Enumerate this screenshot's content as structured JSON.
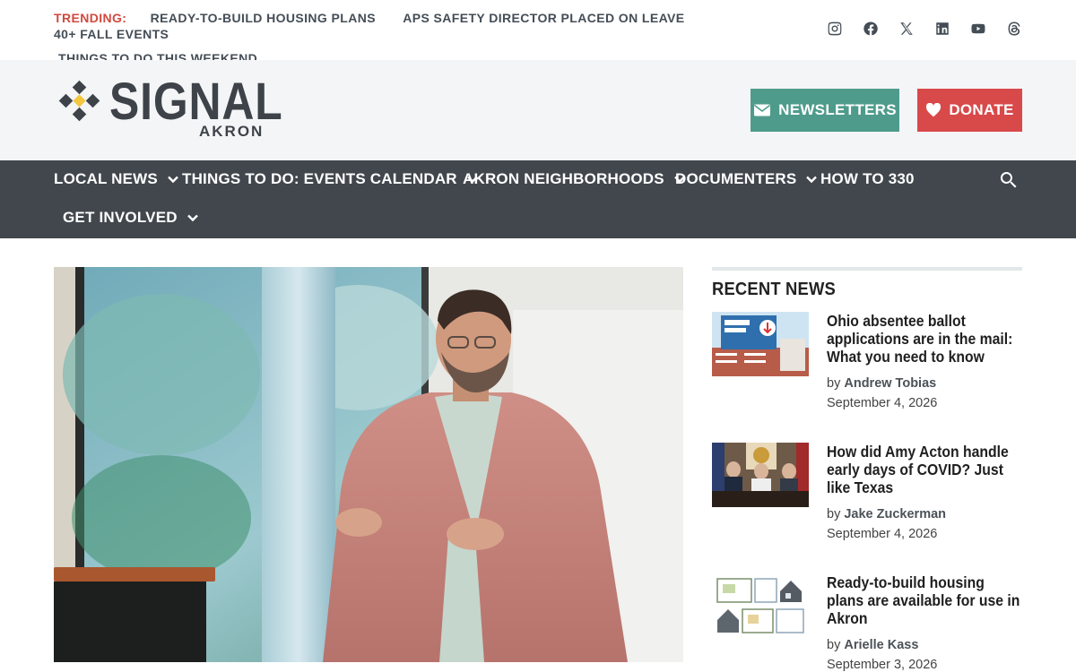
{
  "trending": {
    "label": "TRENDING:",
    "links": [
      "READY-TO-BUILD HOUSING PLANS",
      "APS SAFETY DIRECTOR PLACED ON LEAVE",
      "40+ FALL EVENTS",
      "THINGS TO DO THIS WEEKEND"
    ]
  },
  "social": [
    "instagram-icon",
    "facebook-icon",
    "x-icon",
    "linkedin-icon",
    "youtube-icon",
    "threads-icon"
  ],
  "logo": {
    "word": "SIGNAL",
    "sub": "AKRON"
  },
  "buttons": {
    "newsletters": "NEWSLETTERS",
    "donate": "DONATE"
  },
  "nav": {
    "items": [
      "LOCAL NEWS",
      "THINGS TO DO: EVENTS CALENDAR",
      "AKRON NEIGHBORHOODS",
      "DOCUMENTERS",
      "HOW TO 330",
      "GET INVOLVED"
    ]
  },
  "sidebar": {
    "title": "RECENT NEWS",
    "by": "by",
    "stories": [
      {
        "title": "Ohio absentee ballot applications are in the mail: What you need to know",
        "author": "Andrew Tobias",
        "date": "September 4, 2026"
      },
      {
        "title": "How did Amy Acton handle early days of COVID? Just like Texas",
        "author": "Jake Zuckerman",
        "date": "September 4, 2026"
      },
      {
        "title": "Ready-to-build housing plans are available for use in Akron",
        "author": "Arielle Kass",
        "date": "September 3, 2026"
      }
    ]
  },
  "colors": {
    "accent_red": "#d2493f",
    "nav_bg": "#41474d",
    "newsletter_green": "#4e9b8c",
    "donate_red": "#d8494a"
  }
}
